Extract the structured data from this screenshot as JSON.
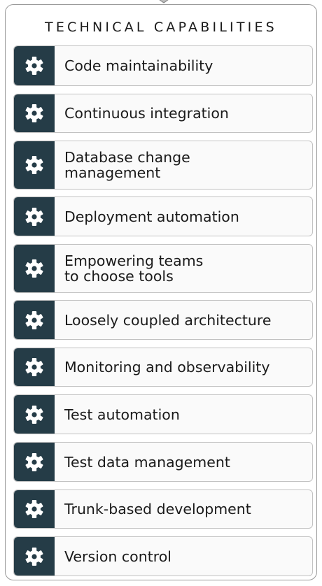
{
  "panel": {
    "title": "TECHNICAL CAPABILITIES"
  },
  "colors": {
    "icon_background": "#253c47",
    "icon_glyph": "#ffffff",
    "item_border": "#c2c2c2",
    "panel_border": "#9a9a9a"
  },
  "items": [
    {
      "label": "Code maintainability",
      "icon": "gear-icon"
    },
    {
      "label": "Continuous integration",
      "icon": "gear-icon"
    },
    {
      "label": "Database change\nmanagement",
      "icon": "gear-icon"
    },
    {
      "label": "Deployment automation",
      "icon": "gear-icon"
    },
    {
      "label": "Empowering teams\nto choose tools",
      "icon": "gear-icon"
    },
    {
      "label": "Loosely coupled architecture",
      "icon": "gear-icon"
    },
    {
      "label": "Monitoring and observability",
      "icon": "gear-icon"
    },
    {
      "label": "Test automation",
      "icon": "gear-icon"
    },
    {
      "label": "Test data management",
      "icon": "gear-icon"
    },
    {
      "label": "Trunk-based development",
      "icon": "gear-icon"
    },
    {
      "label": "Version control",
      "icon": "gear-icon"
    }
  ]
}
